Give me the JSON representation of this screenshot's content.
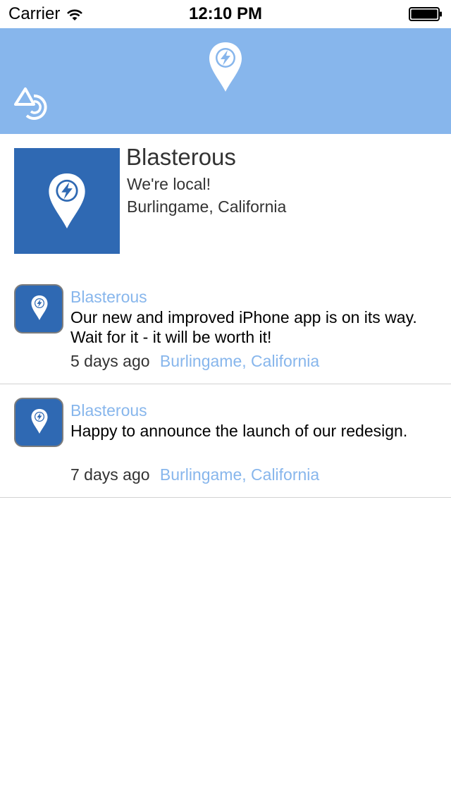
{
  "status_bar": {
    "carrier": "Carrier",
    "time": "12:10 PM"
  },
  "nav_bar": {
    "background": "#87b6ec",
    "logo_icon": "location-pin-bolt-icon",
    "left_button_icon": "refresh-icon"
  },
  "profile": {
    "name": "Blasterous",
    "tagline": "We're local!",
    "location": "Burlingame, California",
    "avatar_color": "#2f69b3"
  },
  "feed": [
    {
      "author": "Blasterous",
      "text": "Our new and improved iPhone app is on its way. Wait for it - it will be worth it!",
      "time": "5 days ago",
      "location": "Burlingame, California"
    },
    {
      "author": "Blasterous",
      "text": "Happy to announce the launch of our redesign.",
      "time": "7 days ago",
      "location": "Burlingame, California"
    }
  ],
  "colors": {
    "accent": "#87b6ec",
    "brand": "#2f69b3"
  }
}
